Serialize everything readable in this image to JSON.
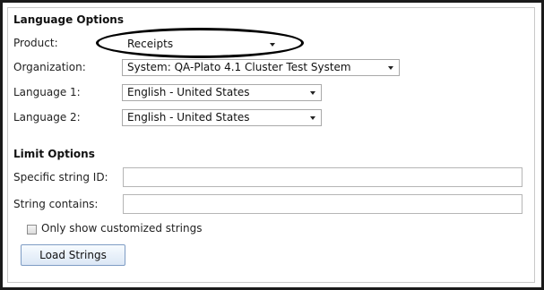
{
  "language_options": {
    "title": "Language Options",
    "product": {
      "label": "Product:",
      "value": "Receipts"
    },
    "organization": {
      "label": "Organization:",
      "value": "System: QA-Plato 4.1 Cluster Test System"
    },
    "language1": {
      "label": "Language 1:",
      "value": "English - United States"
    },
    "language2": {
      "label": "Language 2:",
      "value": "English - United States"
    }
  },
  "limit_options": {
    "title": "Limit Options",
    "specific_string_id": {
      "label": "Specific string ID:",
      "value": ""
    },
    "string_contains": {
      "label": "String contains:",
      "value": ""
    },
    "only_customized": {
      "label": "Only show customized strings",
      "checked": false
    }
  },
  "buttons": {
    "load_strings": "Load Strings"
  },
  "colors": {
    "annotation_ellipse": "#000000",
    "button_border": "#7e9cc4"
  }
}
